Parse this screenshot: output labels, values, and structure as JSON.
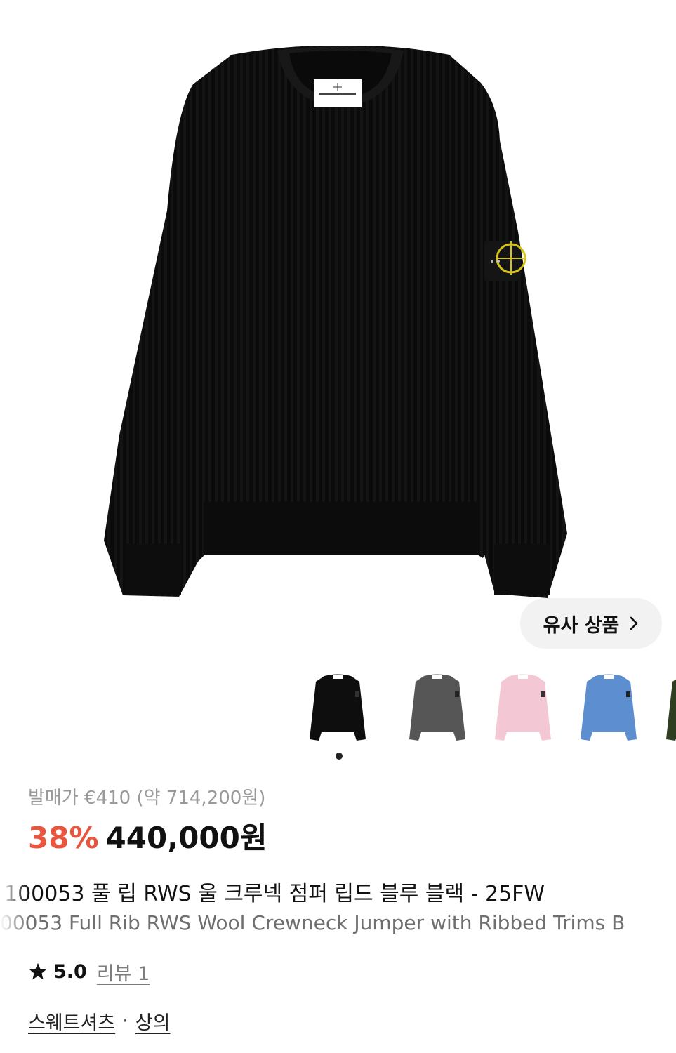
{
  "product": {
    "main_image": "black-ribbed-crewneck-sweater",
    "similar_button": {
      "label": "유사 상품",
      "icon": "chevron-right-icon"
    },
    "color_options": [
      {
        "name": "black",
        "color": "#0e0e0e",
        "selected": true
      },
      {
        "name": "grey",
        "color": "#565656",
        "selected": false
      },
      {
        "name": "pink",
        "color": "#f4c7d4",
        "selected": false
      },
      {
        "name": "blue",
        "color": "#5d8fd0",
        "selected": false
      },
      {
        "name": "olive",
        "color": "#2f3d20",
        "selected": false
      }
    ],
    "retail_price": "발매가 €410 (약 714,200원)",
    "discount": "38%",
    "price": "440,000원",
    "title_ko": "100053 풀 립 RWS 울 크루넥 점퍼 립드 블루 블랙 - 25FW",
    "title_en": "00053 Full Rib RWS Wool Crewneck Jumper with Ribbed Trims B",
    "rating": {
      "icon": "star-icon",
      "score": "5.0",
      "review_label": "리뷰 1"
    },
    "category": {
      "primary": "스웨트셔츠",
      "separator": "·",
      "secondary": "상의"
    }
  },
  "colors": {
    "discount_red": "#e8553f",
    "muted_text": "#9a9a9a",
    "button_bg": "#f2f2f2"
  }
}
